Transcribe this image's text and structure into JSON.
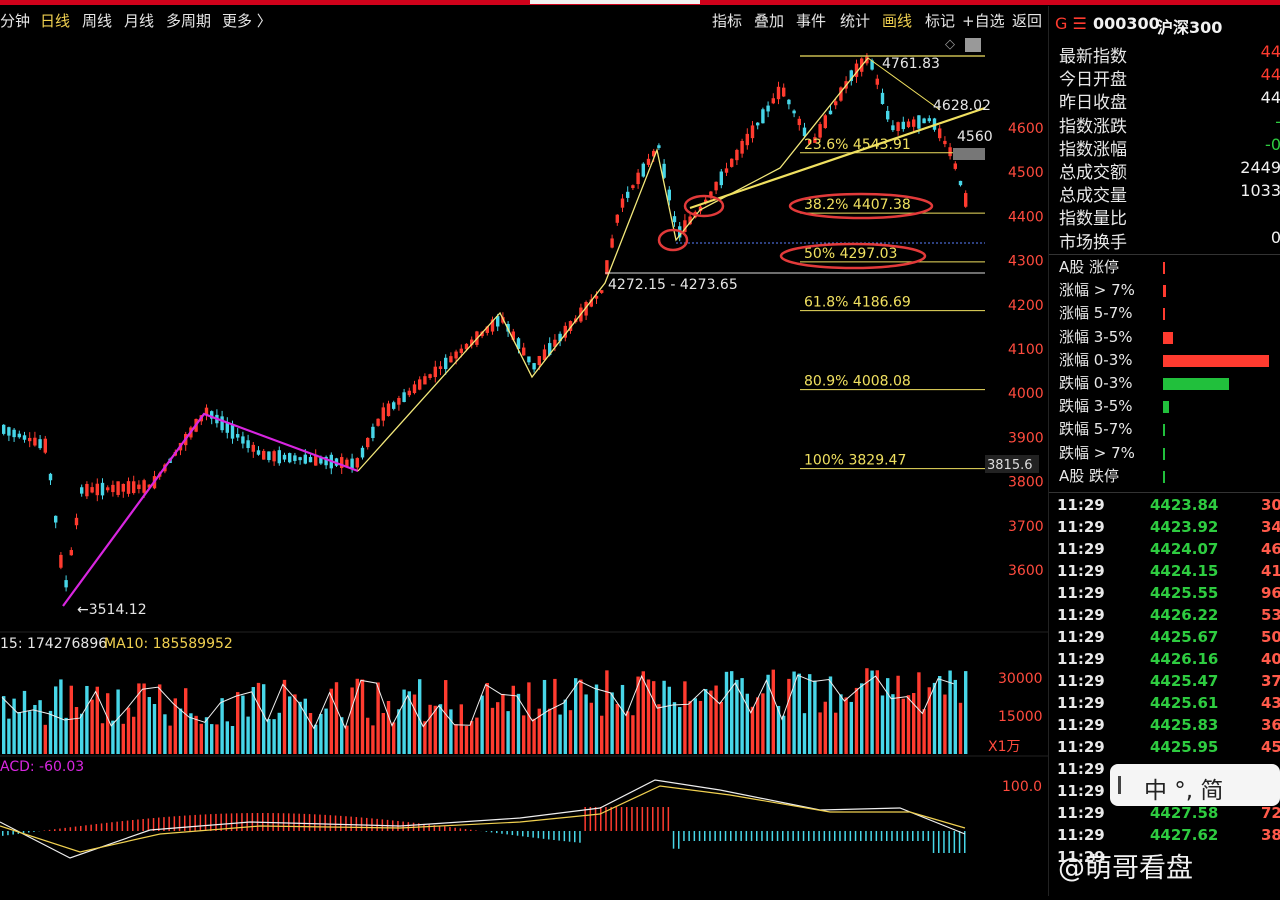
{
  "toolbar": {
    "left": [
      "分钟",
      "日线",
      "周线",
      "月线",
      "多周期",
      "更多 〉"
    ],
    "right": [
      "指标",
      "叠加",
      "事件",
      "统计",
      "画线",
      "标记",
      "+自选",
      "返回"
    ]
  },
  "quote": {
    "prefix": "G ☰",
    "code": "000300",
    "name": "沪深300",
    "labels": [
      "最新指数",
      "今日开盘",
      "昨日收盘",
      "指数涨跌",
      "指数涨幅",
      "总成交额",
      "总成交量",
      "指数量比",
      "市场换手"
    ],
    "values": [
      "44",
      "44",
      "44",
      "-",
      "-0",
      "2449",
      "1033",
      "",
      "0"
    ]
  },
  "distribution": {
    "labels": [
      "A股 涨停",
      "涨幅 > 7%",
      "涨幅 5-7%",
      "涨幅 3-5%",
      "涨幅 0-3%",
      "跌幅 0-3%",
      "跌幅 3-5%",
      "跌幅 5-7%",
      "跌幅 > 7%",
      "A股 跌停"
    ],
    "values": [
      0.01,
      0.03,
      0.02,
      0.09,
      1.0,
      0.62,
      0.06,
      0.01,
      0.02,
      0.01
    ]
  },
  "ticks": [
    {
      "time": "11:29",
      "price": "4423.84",
      "vol": "30"
    },
    {
      "time": "11:29",
      "price": "4423.92",
      "vol": "34"
    },
    {
      "time": "11:29",
      "price": "4424.07",
      "vol": "46"
    },
    {
      "time": "11:29",
      "price": "4424.15",
      "vol": "41"
    },
    {
      "time": "11:29",
      "price": "4425.55",
      "vol": "96"
    },
    {
      "time": "11:29",
      "price": "4426.22",
      "vol": "53"
    },
    {
      "time": "11:29",
      "price": "4425.67",
      "vol": "50"
    },
    {
      "time": "11:29",
      "price": "4426.16",
      "vol": "40"
    },
    {
      "time": "11:29",
      "price": "4425.47",
      "vol": "37"
    },
    {
      "time": "11:29",
      "price": "4425.61",
      "vol": "43"
    },
    {
      "time": "11:29",
      "price": "4425.83",
      "vol": "36"
    },
    {
      "time": "11:29",
      "price": "4425.95",
      "vol": "45"
    },
    {
      "time": "11:29",
      "price": "",
      "vol": ""
    },
    {
      "time": "11:29",
      "price": "",
      "vol": ""
    },
    {
      "time": "11:29",
      "price": "4427.58",
      "vol": "72"
    },
    {
      "time": "11:29",
      "price": "4427.62",
      "vol": "38"
    },
    {
      "time": "11:29",
      "price": "",
      "vol": ""
    }
  ],
  "ime": {
    "text": "中 °, 简"
  },
  "watermark": "@萌哥看盘",
  "chart": {
    "price_axis": [
      "4600",
      "4500",
      "4400",
      "4300",
      "4200",
      "4100",
      "4000",
      "3900",
      "3800",
      "3700",
      "3600"
    ],
    "current_price": "3815.6",
    "annotations": {
      "high": "4761.83",
      "p4628": "4628.02",
      "p4560": "4560",
      "low": "3514.12",
      "gap": "4272.15 - 4273.65"
    },
    "fib": [
      {
        "label": "23.6% 4543.91",
        "price": 4543.91
      },
      {
        "label": "38.2% 4407.38",
        "price": 4407.38
      },
      {
        "label": "50% 4297.03",
        "price": 4297.03
      },
      {
        "label": "61.8% 4186.69",
        "price": 4186.69
      },
      {
        "label": "80.9% 4008.08",
        "price": 4008.08
      },
      {
        "label": "100% 3829.47",
        "price": 3829.47
      }
    ],
    "volume": {
      "ma5": "15: 174276896",
      "ma10": "MA10: 185589952",
      "axis": [
        "30000",
        "15000"
      ],
      "unit": "X1万"
    },
    "macd": {
      "label": "ACD: -60.03",
      "axis": "100.0"
    }
  },
  "colors": {
    "up": "#ff3b2f",
    "down": "#47d6e8",
    "fib": "#f0e060",
    "pivot": "#d826e0",
    "hl": "#e23a3a"
  }
}
